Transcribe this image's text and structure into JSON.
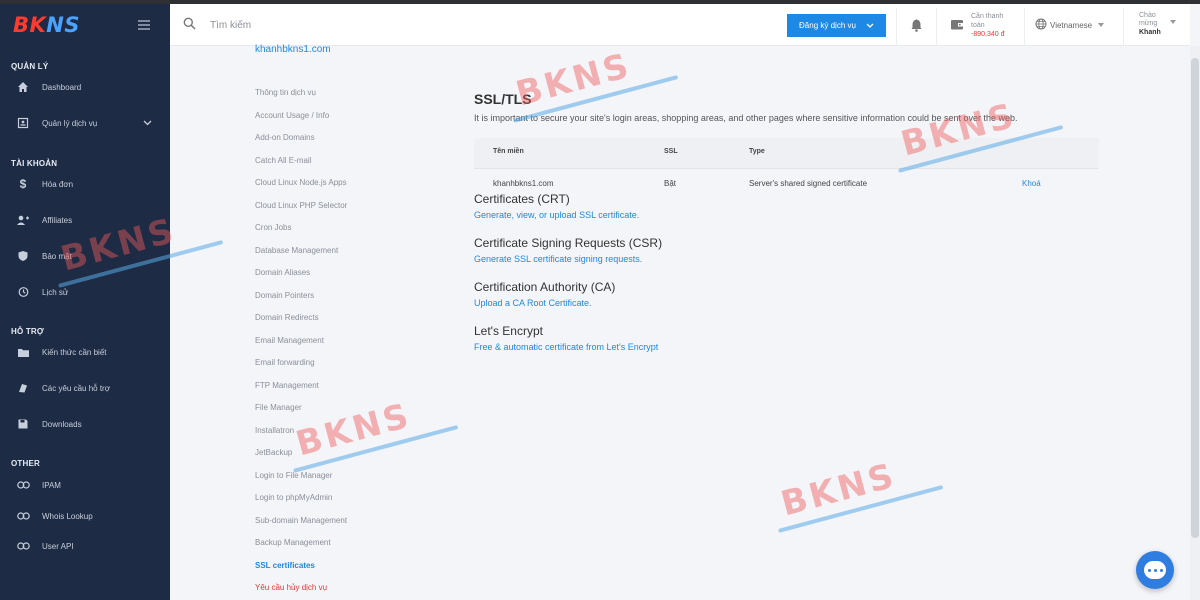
{
  "app": {
    "brand_prefix": "BK",
    "brand_suffix": "NS"
  },
  "colors": {
    "sidebar": "#1d2b44",
    "accent": "#1e88e5",
    "danger": "#e53935"
  },
  "sidebar": {
    "sections": [
      {
        "title": "QUẢN LÝ"
      },
      {
        "title": "TÀI KHOẢN"
      },
      {
        "title": "HỖ TRỢ"
      },
      {
        "title": "OTHER"
      }
    ],
    "items": [
      {
        "label": "Dashboard",
        "icon": "home-icon"
      },
      {
        "label": "Quản lý dịch vụ",
        "icon": "services-icon"
      },
      {
        "label": "Hóa đơn",
        "icon": "dollar-icon"
      },
      {
        "label": "Affiliates",
        "icon": "users-icon"
      },
      {
        "label": "Bảo mật",
        "icon": "shield-icon"
      },
      {
        "label": "Lịch sử",
        "icon": "history-icon"
      },
      {
        "label": "Kiến thức cần biết",
        "icon": "folder-icon"
      },
      {
        "label": "Các yêu cầu hỗ trợ",
        "icon": "support-icon"
      },
      {
        "label": "Downloads",
        "icon": "save-icon"
      },
      {
        "label": "IPAM",
        "icon": "link-icon"
      },
      {
        "label": "Whois Lookup",
        "icon": "link-icon"
      },
      {
        "label": "User API",
        "icon": "link-icon"
      }
    ]
  },
  "header": {
    "search_placeholder": "Tìm kiếm",
    "register_label": "Đăng ký dịch vụ",
    "payment_label": "Cần thanh toán",
    "payment_value": "-890,340 đ",
    "language": "Vietnamese",
    "greeting": "Chào mừng",
    "username": "Khanh"
  },
  "submenu": {
    "domain": "khanhbkns1.com",
    "items": [
      {
        "label": "Thông tin dịch vụ"
      },
      {
        "label": "Account Usage / Info"
      },
      {
        "label": "Add-on Domains"
      },
      {
        "label": "Catch All E-mail"
      },
      {
        "label": "Cloud Linux Node.js Apps"
      },
      {
        "label": "Cloud Linux PHP Selector"
      },
      {
        "label": "Cron Jobs"
      },
      {
        "label": "Database Management"
      },
      {
        "label": "Domain Aliases"
      },
      {
        "label": "Domain Pointers"
      },
      {
        "label": "Domain Redirects"
      },
      {
        "label": "Email Management"
      },
      {
        "label": "Email forwarding"
      },
      {
        "label": "FTP Management"
      },
      {
        "label": "File Manager"
      },
      {
        "label": "Installatron"
      },
      {
        "label": "JetBackup"
      },
      {
        "label": "Login to File Manager"
      },
      {
        "label": "Login to phpMyAdmin"
      },
      {
        "label": "Sub-domain Management"
      },
      {
        "label": "Backup Management"
      },
      {
        "label": "SSL certificates"
      },
      {
        "label": "Yêu cầu hủy dịch vụ"
      }
    ]
  },
  "main": {
    "title": "SSL/TLS",
    "description": "It is important to secure your site's login areas, shopping areas, and other pages where sensitive information could be sent over the web.",
    "table": {
      "headers": [
        "Tên miền",
        "SSL",
        "Type"
      ],
      "rows": [
        {
          "domain": "khanhbkns1.com",
          "ssl": "Bật",
          "type": "Server's shared signed certificate",
          "action": "Khoá"
        }
      ]
    },
    "sections": [
      {
        "title": "Certificates (CRT)",
        "link": "Generate, view, or upload SSL certificate."
      },
      {
        "title": "Certificate Signing Requests (CSR)",
        "link": "Generate SSL certificate signing requests."
      },
      {
        "title": "Certification Authority (CA)",
        "link": "Upload a CA Root Certificate."
      },
      {
        "title": "Let's Encrypt",
        "link": "Free & automatic certificate from Let's Encrypt"
      }
    ]
  },
  "watermark": "BKNS"
}
